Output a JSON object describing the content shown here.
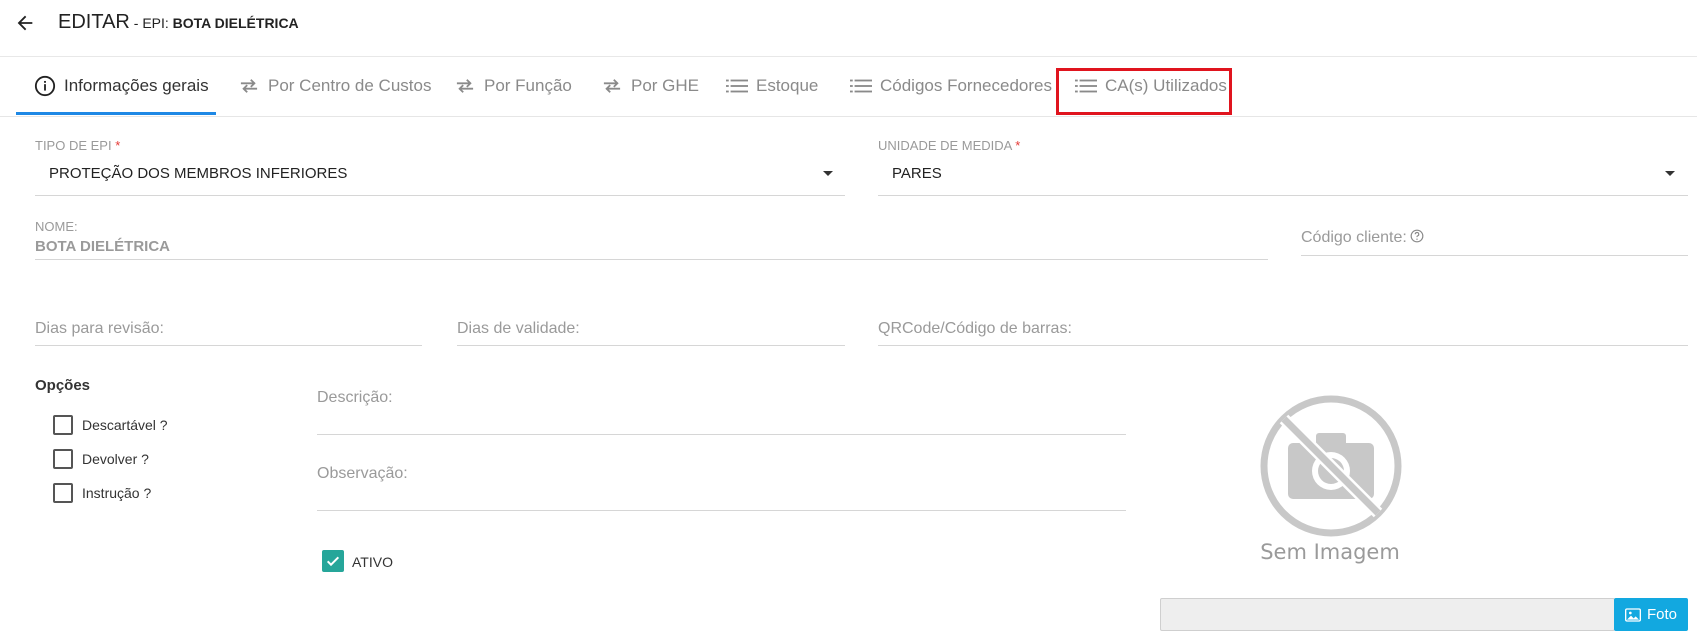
{
  "header": {
    "title": "EDITAR",
    "separator": " - ",
    "sub_prefix": "EPI: ",
    "sub_value": "BOTA DIELÉTRICA"
  },
  "tabs": [
    {
      "label": "Informações gerais",
      "icon": "info-icon"
    },
    {
      "label": "Por Centro de Custos",
      "icon": "swap-icon"
    },
    {
      "label": "Por Função",
      "icon": "swap-icon"
    },
    {
      "label": "Por GHE",
      "icon": "swap-icon"
    },
    {
      "label": "Estoque",
      "icon": "list-icon"
    },
    {
      "label": "Códigos Fornecedores",
      "icon": "list-icon"
    },
    {
      "label": "CA(s) Utilizados",
      "icon": "list-icon"
    }
  ],
  "form": {
    "tipo_epi": {
      "label": "TIPO DE EPI",
      "required": "*",
      "value": "PROTEÇÃO DOS MEMBROS INFERIORES"
    },
    "unidade": {
      "label": "UNIDADE DE MEDIDA",
      "required": "*",
      "value": "PARES"
    },
    "nome": {
      "label": "NOME:",
      "value": "BOTA DIELÉTRICA"
    },
    "codigo_cliente": {
      "label": "Código cliente:"
    },
    "dias_revisao": {
      "label": "Dias para revisão:"
    },
    "dias_validade": {
      "label": "Dias de validade:"
    },
    "qrcode": {
      "label": "QRCode/Código de barras:"
    },
    "descricao": {
      "label": "Descrição:"
    },
    "observacao": {
      "label": "Observação:"
    }
  },
  "options": {
    "title": "Opções",
    "items": [
      {
        "label": "Descartável ?",
        "checked": false
      },
      {
        "label": "Devolver ?",
        "checked": false
      },
      {
        "label": "Instrução ?",
        "checked": false
      }
    ]
  },
  "ativo": {
    "label": "ATIVO",
    "checked": true
  },
  "image": {
    "placeholder_text": "Sem Imagem",
    "button_label": "Foto"
  },
  "colors": {
    "accent": "#1e88e5",
    "highlight": "#e0141e",
    "check": "#26a69a",
    "button": "#12a8e0"
  }
}
